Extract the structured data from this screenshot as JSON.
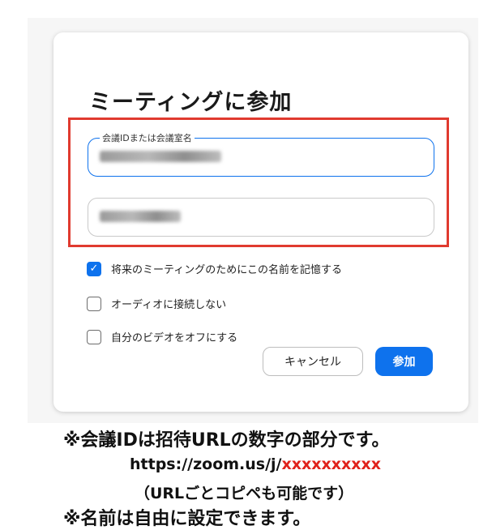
{
  "dialog": {
    "title": "ミーティングに参加",
    "meeting_field": {
      "label": "会議IDまたは会議室名",
      "value_redacted": true
    },
    "name_field": {
      "value_redacted": true
    },
    "options": [
      {
        "label": "将来のミーティングのためにこの名前を記憶する",
        "checked": true
      },
      {
        "label": "オーディオに接続しない",
        "checked": false
      },
      {
        "label": "自分のビデオをオフにする",
        "checked": false
      }
    ],
    "cancel_label": "キャンセル",
    "join_label": "参加"
  },
  "notes": {
    "line1": "※会議IDは招待URLの数字の部分です。",
    "url_prefix": "https://zoom.us/j/",
    "url_placeholder": "xxxxxxxxxx",
    "line3": "（URLごとコピペも可能です）",
    "line4": "※名前は自由に設定できます。"
  },
  "colors": {
    "accent": "#0e72ed",
    "highlight_box": "#e03a2f",
    "url_placeholder": "#e0211b"
  },
  "icons": {
    "checkbox_checked": "checkmark-icon"
  }
}
